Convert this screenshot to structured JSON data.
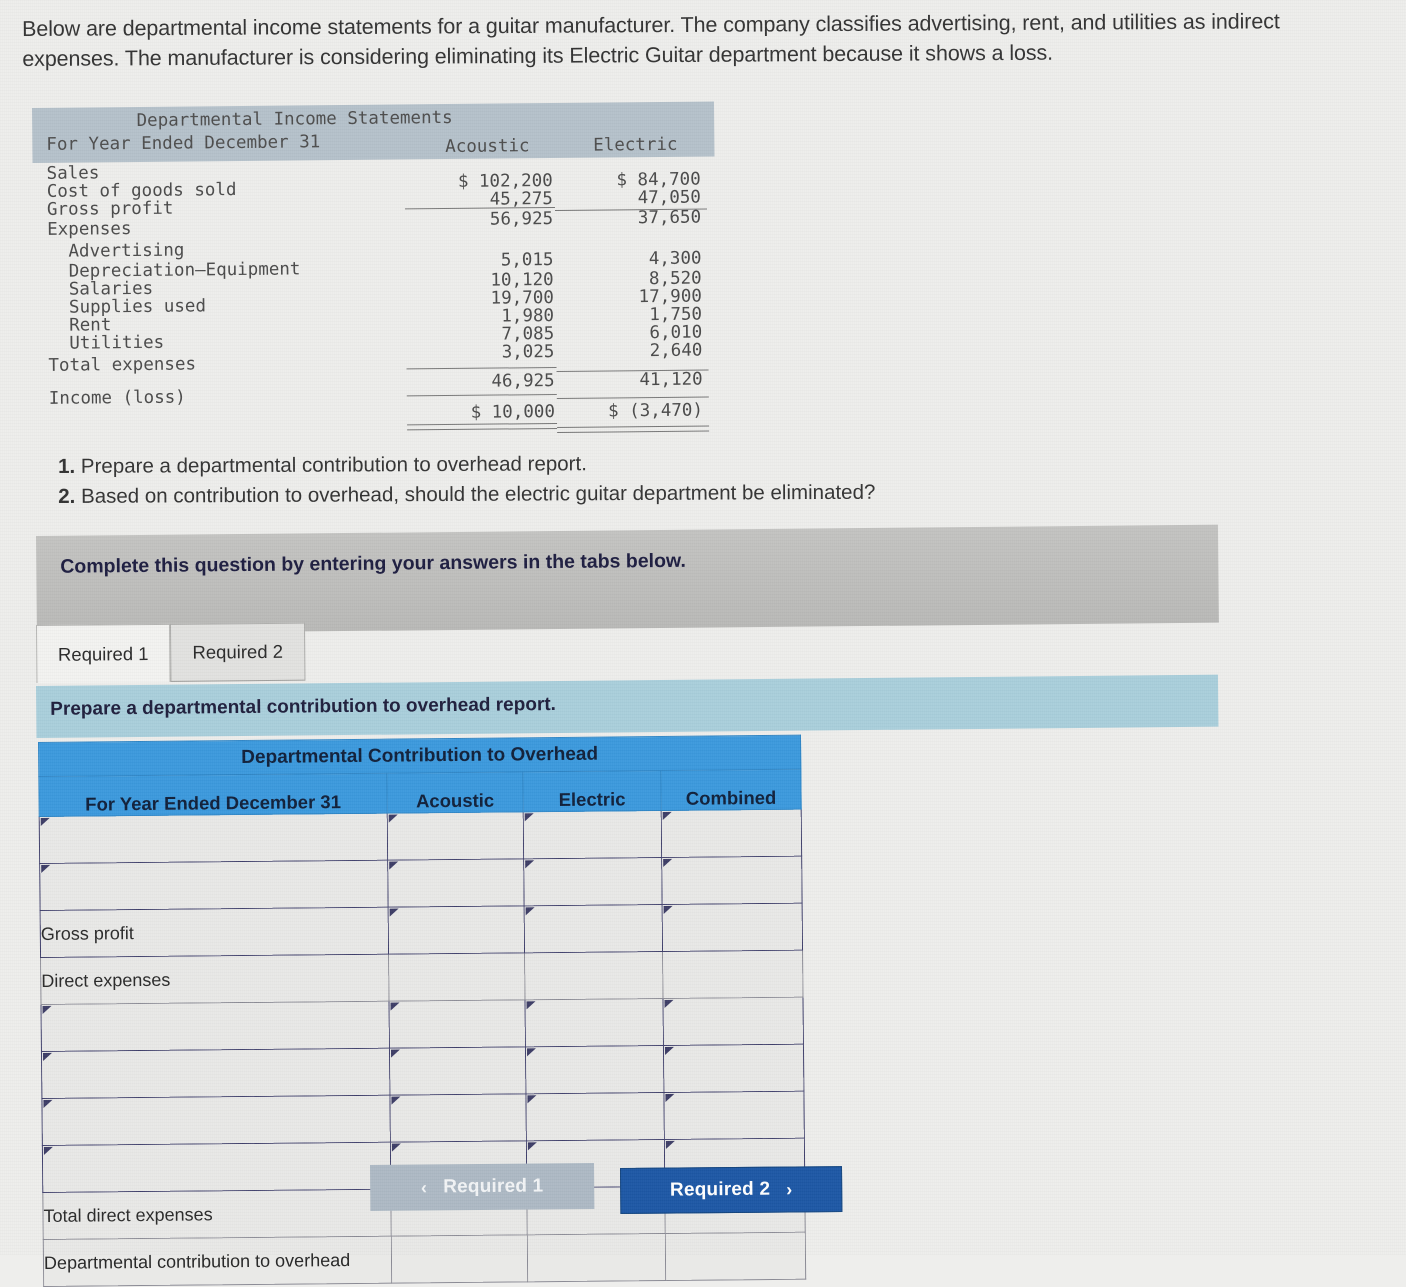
{
  "intro": {
    "paragraph": "Below are departmental income statements for a guitar manufacturer. The company classifies advertising, rent, and utilities as indirect expenses. The manufacturer is considering eliminating its Electric Guitar department because it shows a loss."
  },
  "income_statement": {
    "title": "Departmental Income Statements",
    "subtitle": "For Year Ended December 31",
    "columns": [
      "Acoustic",
      "Electric"
    ],
    "rows": [
      {
        "label": "Sales",
        "acoustic": "$ 102,200",
        "electric": "$ 84,700"
      },
      {
        "label": "Cost of goods sold",
        "acoustic": "45,275",
        "electric": "47,050"
      },
      {
        "label": "Gross profit",
        "acoustic": "56,925",
        "electric": "37,650"
      },
      {
        "label": "Expenses",
        "acoustic": "",
        "electric": ""
      },
      {
        "label": "  Advertising",
        "acoustic": "5,015",
        "electric": "4,300"
      },
      {
        "label": "  Depreciation–Equipment",
        "acoustic": "10,120",
        "electric": "8,520"
      },
      {
        "label": "  Salaries",
        "acoustic": "19,700",
        "electric": "17,900"
      },
      {
        "label": "  Supplies used",
        "acoustic": "1,980",
        "electric": "1,750"
      },
      {
        "label": "  Rent",
        "acoustic": "7,085",
        "electric": "6,010"
      },
      {
        "label": "  Utilities",
        "acoustic": "3,025",
        "electric": "2,640"
      },
      {
        "label": "Total expenses",
        "acoustic": "46,925",
        "electric": "41,120"
      },
      {
        "label": "Income (loss)",
        "acoustic": "$ 10,000",
        "electric": "$ (3,470)"
      }
    ]
  },
  "requirements": {
    "item1_num": "1.",
    "item1_text": "Prepare a departmental contribution to overhead report.",
    "item2_num": "2.",
    "item2_text": "Based on contribution to overhead, should the electric guitar department be eliminated?"
  },
  "gray_banner": {
    "text": "Complete this question by entering your answers in the tabs below."
  },
  "tabs": [
    {
      "label": "Required 1",
      "active": true
    },
    {
      "label": "Required 2",
      "active": false
    }
  ],
  "blue_banner": {
    "text": "Prepare a departmental contribution to overhead report."
  },
  "answer_table": {
    "title": "Departmental Contribution to Overhead",
    "headers": [
      "For Year Ended December 31",
      "Acoustic",
      "Electric",
      "Combined"
    ],
    "rows": [
      {
        "label": "",
        "label_editable": true,
        "cells_editable": true,
        "acoustic": "",
        "electric": "",
        "combined": ""
      },
      {
        "label": "",
        "label_editable": true,
        "cells_editable": true,
        "acoustic": "",
        "electric": "",
        "combined": ""
      },
      {
        "label": "Gross profit",
        "label_editable": false,
        "cells_editable": true,
        "acoustic": "",
        "electric": "",
        "combined": ""
      },
      {
        "label": "Direct expenses",
        "label_editable": false,
        "cells_editable": false,
        "acoustic": "",
        "electric": "",
        "combined": ""
      },
      {
        "label": "",
        "label_editable": true,
        "cells_editable": true,
        "acoustic": "",
        "electric": "",
        "combined": ""
      },
      {
        "label": "",
        "label_editable": true,
        "cells_editable": true,
        "acoustic": "",
        "electric": "",
        "combined": ""
      },
      {
        "label": "",
        "label_editable": true,
        "cells_editable": true,
        "acoustic": "",
        "electric": "",
        "combined": ""
      },
      {
        "label": "",
        "label_editable": true,
        "cells_editable": true,
        "acoustic": "",
        "electric": "",
        "combined": ""
      },
      {
        "label": "Total direct expenses",
        "label_editable": false,
        "cells_editable": false,
        "acoustic": "",
        "electric": "",
        "combined": ""
      },
      {
        "label": "Departmental contribution to overhead",
        "label_editable": false,
        "cells_editable": false,
        "acoustic": "",
        "electric": "",
        "combined": ""
      }
    ]
  },
  "nav": {
    "prev_label": "Required 1",
    "prev_chevron": "‹",
    "next_label": "Required 2",
    "next_chevron": "›"
  },
  "colors": {
    "page_background": "#eeeeec",
    "statement_header": "#b5c1ca",
    "gray_banner": "#bdbdbb",
    "blue_banner": "#a9cedb",
    "table_header_blue": "#3b99dd",
    "next_button_blue": "#1c57a5",
    "prev_button_gray": "#adb9c4"
  }
}
